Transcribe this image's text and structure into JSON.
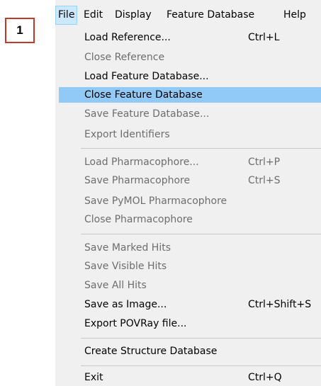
{
  "step_badge": "1",
  "menubar": {
    "items": [
      {
        "label": "File"
      },
      {
        "label": "Edit"
      },
      {
        "label": "Display"
      },
      {
        "label": "Feature Database"
      },
      {
        "label": "Help"
      }
    ]
  },
  "file_menu": {
    "items": [
      {
        "label": "Load Reference...",
        "shortcut": "Ctrl+L",
        "enabled": true
      },
      {
        "label": "Close Reference",
        "shortcut": "",
        "enabled": false
      },
      {
        "label": "Load Feature Database...",
        "shortcut": "",
        "enabled": true
      },
      {
        "label": "Close Feature Database",
        "shortcut": "",
        "enabled": true,
        "highlighted": true
      },
      {
        "label": "Save Feature Database...",
        "shortcut": "",
        "enabled": false
      },
      {
        "label": "Export Identifiers",
        "shortcut": "",
        "enabled": false
      },
      {
        "label": "Load Pharmacophore...",
        "shortcut": "Ctrl+P",
        "enabled": false
      },
      {
        "label": "Save Pharmacophore",
        "shortcut": "Ctrl+S",
        "enabled": false
      },
      {
        "label": "Save PyMOL Pharmacophore",
        "shortcut": "",
        "enabled": false
      },
      {
        "label": "Close Pharmacophore",
        "shortcut": "",
        "enabled": false
      },
      {
        "label": "Save Marked Hits",
        "shortcut": "",
        "enabled": false
      },
      {
        "label": "Save Visible Hits",
        "shortcut": "",
        "enabled": false
      },
      {
        "label": "Save All Hits",
        "shortcut": "",
        "enabled": false
      },
      {
        "label": "Save as Image...",
        "shortcut": "Ctrl+Shift+S",
        "enabled": true
      },
      {
        "label": "Export POVRay file...",
        "shortcut": "",
        "enabled": true
      },
      {
        "label": "Create Structure Database",
        "shortcut": "",
        "enabled": true
      },
      {
        "label": "Exit",
        "shortcut": "Ctrl+Q",
        "enabled": true
      }
    ]
  }
}
